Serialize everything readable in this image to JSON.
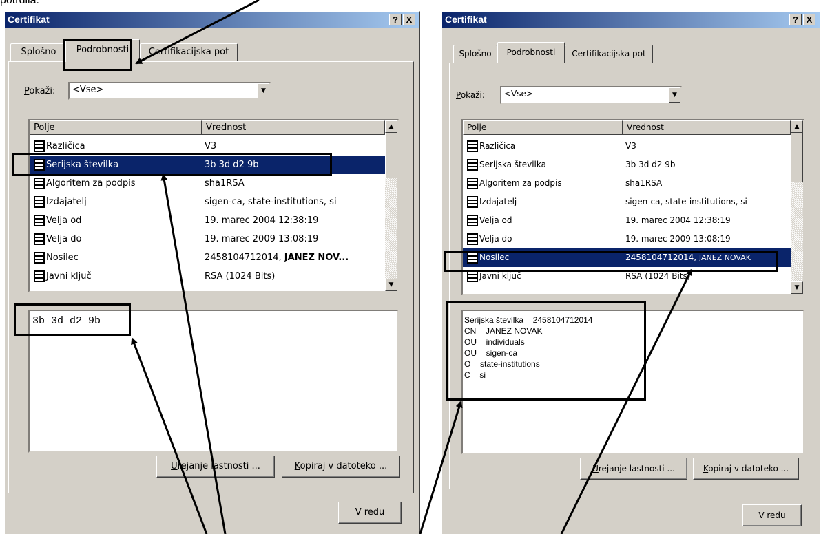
{
  "page_text": {
    "top_fragment": "potrdila."
  },
  "left_dialog": {
    "title": "Certifikat",
    "buttons": {
      "help": "?",
      "close": "X",
      "edit_prefix": "U",
      "edit_rest": "rejanje lastnosti ...",
      "copy_prefix": "K",
      "copy_rest": "opiraj v datoteko ...",
      "ok": "V redu"
    },
    "tabs": [
      "Splošno",
      "Podrobnosti",
      "Certifikacijska pot"
    ],
    "show_label_prefix": "P",
    "show_label_rest": "okaži:",
    "show_value": "<Vse>",
    "columns": [
      "Polje",
      "Vrednost"
    ],
    "rows": [
      {
        "field": "Različica",
        "value": "V3"
      },
      {
        "field": "Serijska številka",
        "value": "3b 3d d2 9b",
        "selected": true
      },
      {
        "field": "Algoritem za podpis",
        "value": "sha1RSA"
      },
      {
        "field": "Izdajatelj",
        "value": "sigen-ca, state-institutions, si"
      },
      {
        "field": "Velja od",
        "value": "19. marec 2004 12:38:19"
      },
      {
        "field": "Velja do",
        "value": "19. marec 2009 13:08:19"
      },
      {
        "field": "Nosilec",
        "value_prefix": "2458104712014, ",
        "value_bold": "JANEZ NOV..."
      },
      {
        "field": "Javni ključ",
        "value": "RSA (1024 Bits)"
      }
    ],
    "detail_text": "3b 3d d2 9b"
  },
  "right_dialog": {
    "title": "Certifikat",
    "buttons": {
      "help": "?",
      "close": "X",
      "edit_prefix": "U",
      "edit_rest": "rejanje lastnosti ...",
      "copy_prefix": "K",
      "copy_rest": "opiraj v datoteko ...",
      "ok": "V redu"
    },
    "tabs": [
      "Splošno",
      "Podrobnosti",
      "Certifikacijska pot"
    ],
    "show_label_prefix": "P",
    "show_label_rest": "okaži:",
    "show_value": "<Vse>",
    "columns": [
      "Polje",
      "Vrednost"
    ],
    "rows": [
      {
        "field": "Različica",
        "value": "V3"
      },
      {
        "field": "Serijska številka",
        "value": "3b 3d d2 9b"
      },
      {
        "field": "Algoritem za podpis",
        "value": "sha1RSA"
      },
      {
        "field": "Izdajatelj",
        "value": "sigen-ca, state-institutions, si"
      },
      {
        "field": "Velja od",
        "value": "19. marec 2004 12:38:19"
      },
      {
        "field": "Velja do",
        "value": "19. marec 2009 13:08:19"
      },
      {
        "field": "Nosilec",
        "value_prefix": "2458104712014, ",
        "value_bold": "JANEZ NOVAK",
        "selected": true
      },
      {
        "field": "Javni ključ",
        "value": "RSA (1024 Bits)"
      }
    ],
    "detail_lines": [
      "Serijska številka = 2458104712014",
      "CN = JANEZ NOVAK",
      "OU = individuals",
      "OU = sigen-ca",
      "O = state-institutions",
      "C = si"
    ]
  },
  "colors": {
    "dialog_bg": "#d4d0c8",
    "title_start": "#0a246a",
    "title_end": "#a6caf0",
    "selection": "#0a246a",
    "annotation": "#000000"
  }
}
